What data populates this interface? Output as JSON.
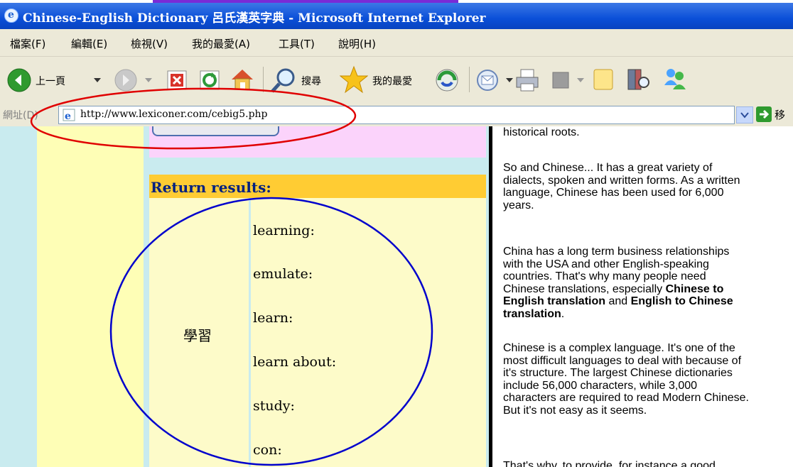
{
  "window": {
    "title": "Chinese-English Dictionary 呂氏漢英字典 - Microsoft Internet Explorer"
  },
  "menu": {
    "items": [
      "檔案(F)",
      "編輯(E)",
      "檢視(V)",
      "我的最愛(A)",
      "工具(T)",
      "說明(H)"
    ]
  },
  "toolbar": {
    "back_label": "上一頁",
    "search_label": "搜尋",
    "favorites_label": "我的最愛"
  },
  "address": {
    "label": "網址(D)",
    "url": "http://www.lexiconer.com/cebig5.php",
    "go_label": "移"
  },
  "results": {
    "header": "Return results:",
    "word": "學習",
    "definitions": [
      "learning:",
      "emulate:",
      "learn:",
      "learn about:",
      "study:",
      "con:"
    ]
  },
  "article": {
    "p0": "historical roots.",
    "p1_lines": [
      "So and Chinese... It has a great variety of",
      "dialects, spoken and written forms. As a written",
      "language, Chinese has been used for 6,000",
      "years."
    ],
    "p2_lines": [
      "China has a long term business relationships",
      "with the USA and other English-speaking",
      "countries. That's why many people need"
    ],
    "p2_line4": "Chinese translations, especially ",
    "p2_bold1": "Chinese to",
    "p2_bold2": "English translation",
    "p2_and": " and ",
    "p2_bold3": "English to Chinese",
    "p2_bold4": "translation",
    "p2_end": ".",
    "p3_lines": [
      "Chinese is a complex language. It's one of the",
      "most difficult languages to deal with because of",
      "it's structure. The largest Chinese dictionaries",
      "include 56,000 characters, while 3,000",
      "characters are required to read Modern Chinese.",
      "But it's not easy as it seems."
    ],
    "p4": "That's why, to provide, for instance a good"
  },
  "colors": {
    "titlebar": "#0a4fd8",
    "annotation_red": "#e00000",
    "annotation_blue": "#0000cc",
    "results_header_bg": "#ffcc33"
  }
}
